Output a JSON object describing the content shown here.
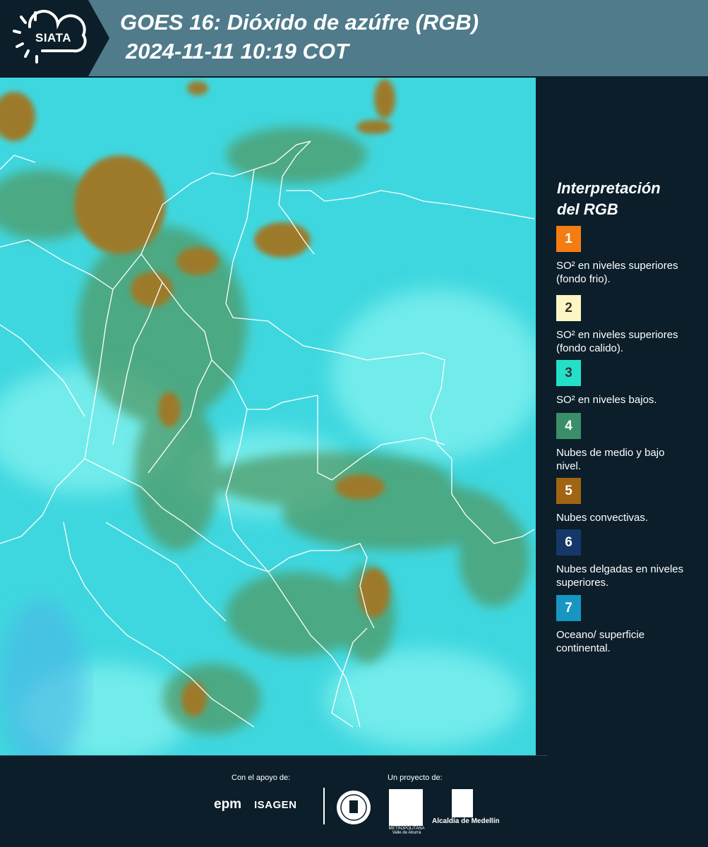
{
  "header": {
    "logo_text": "SIATA",
    "title_line1": "GOES 16: Dióxido de azúfre (RGB)",
    "title_line2": "2024-11-11 10:19 COT",
    "background_color": "#4f7b8b",
    "logo_background_color": "#0b1e2a"
  },
  "legend": {
    "title_line1": "Interpretación",
    "title_line2": "del RGB",
    "items": [
      {
        "number": "1",
        "color": "#f57c12",
        "text_color": "#ffffff",
        "description": "SO² en niveles superiores (fondo frio)."
      },
      {
        "number": "2",
        "color": "#fcf5c4",
        "text_color": "#333333",
        "description": "SO² en niveles superiores (fondo calido)."
      },
      {
        "number": "3",
        "color": "#25e0c8",
        "text_color": "#333333",
        "description": "SO² en niveles bajos."
      },
      {
        "number": "4",
        "color": "#3a8f6a",
        "text_color": "#ffffff",
        "description": "Nubes de medio y bajo nivel."
      },
      {
        "number": "5",
        "color": "#a06413",
        "text_color": "#ffffff",
        "description": "Nubes convectivas."
      },
      {
        "number": "6",
        "color": "#163868",
        "text_color": "#ffffff",
        "description": "Nubes delgadas en niveles superiores."
      },
      {
        "number": "7",
        "color": "#1796c2",
        "text_color": "#ffffff",
        "description": "Oceano/ superficie continental."
      }
    ]
  },
  "footer": {
    "support_label": "Con el apoyo de:",
    "project_label": "Un proyecto de:",
    "epm_logo": "epm",
    "isagen_logo": "ISAGEN",
    "amva_logo": "METROPOLITANA Valle de Aburrá",
    "alcaldia_logo": "Alcaldía de Medellín"
  },
  "map": {
    "ocean_color": "#3fd7df",
    "convective_color": "#9c7a2c",
    "midlevel_color": "#4f9a66",
    "border_color": "#ffffff"
  }
}
